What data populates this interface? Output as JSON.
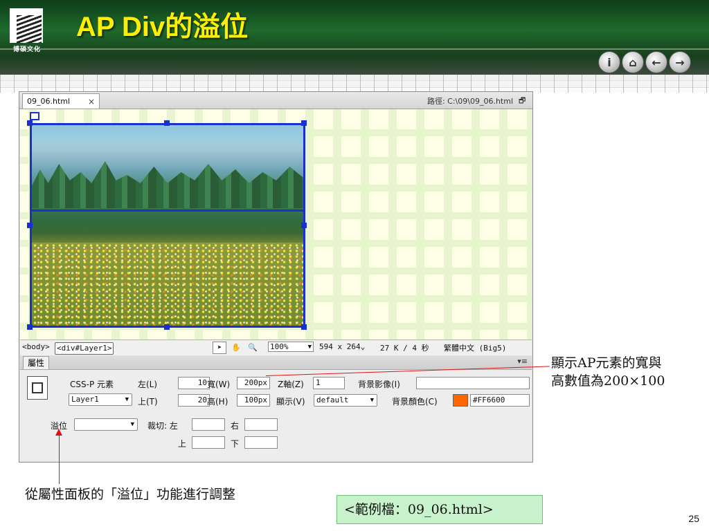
{
  "slide": {
    "title": "AP Div的溢位",
    "logo_text": "博碩文化",
    "nav_buttons": [
      "i",
      "⌂",
      "←",
      "→"
    ],
    "page_number": "25"
  },
  "window": {
    "tab_label": "09_06.html",
    "tab_close": "×",
    "path_text": "路徑: C:\\09\\09_06.html",
    "restore_icon": "🗗"
  },
  "statusbar": {
    "tag_body": "<body>",
    "tag_div": "<div#Layer1>",
    "zoom": "100%",
    "size": "594 x 264",
    "size_dd": "⌄",
    "download": "27 K / 4 秒",
    "encoding": "繁體中文 (Big5)"
  },
  "properties": {
    "panel_title": "屬性",
    "panel_menu": "▾≡",
    "element_type": "CSS-P 元素",
    "layer_name": "Layer1",
    "left_label": "左(L)",
    "left_value": "10",
    "top_label": "上(T)",
    "top_value": "20",
    "width_label": "寬(W)",
    "width_value": "200px",
    "height_label": "高(H)",
    "height_value": "100px",
    "z_label": "Z軸(Z)",
    "z_value": "1",
    "visibility_label": "顯示(V)",
    "visibility_value": "default",
    "bg_image_label": "背景影像(I)",
    "bg_image_value": "",
    "bg_color_label": "背景顏色(C)",
    "bg_color_value": "#FF6600",
    "overflow_label": "溢位",
    "overflow_value": "",
    "clip_label": "裁切: 左",
    "clip_right_label": "右",
    "clip_top_label": "上",
    "clip_bottom_label": "下"
  },
  "annotations": {
    "size_note_line1": "顯示AP元素的寬與",
    "size_note_line2": "高數值為200×100",
    "overflow_note": "從屬性面板的「溢位」功能進行調整",
    "example_file": "<範例檔：09_06.html>"
  },
  "colors": {
    "title": "#ffee00",
    "selection_blue": "#1a2fd0",
    "annotation_red": "#e01010",
    "bg_swatch": "#FF6600"
  }
}
